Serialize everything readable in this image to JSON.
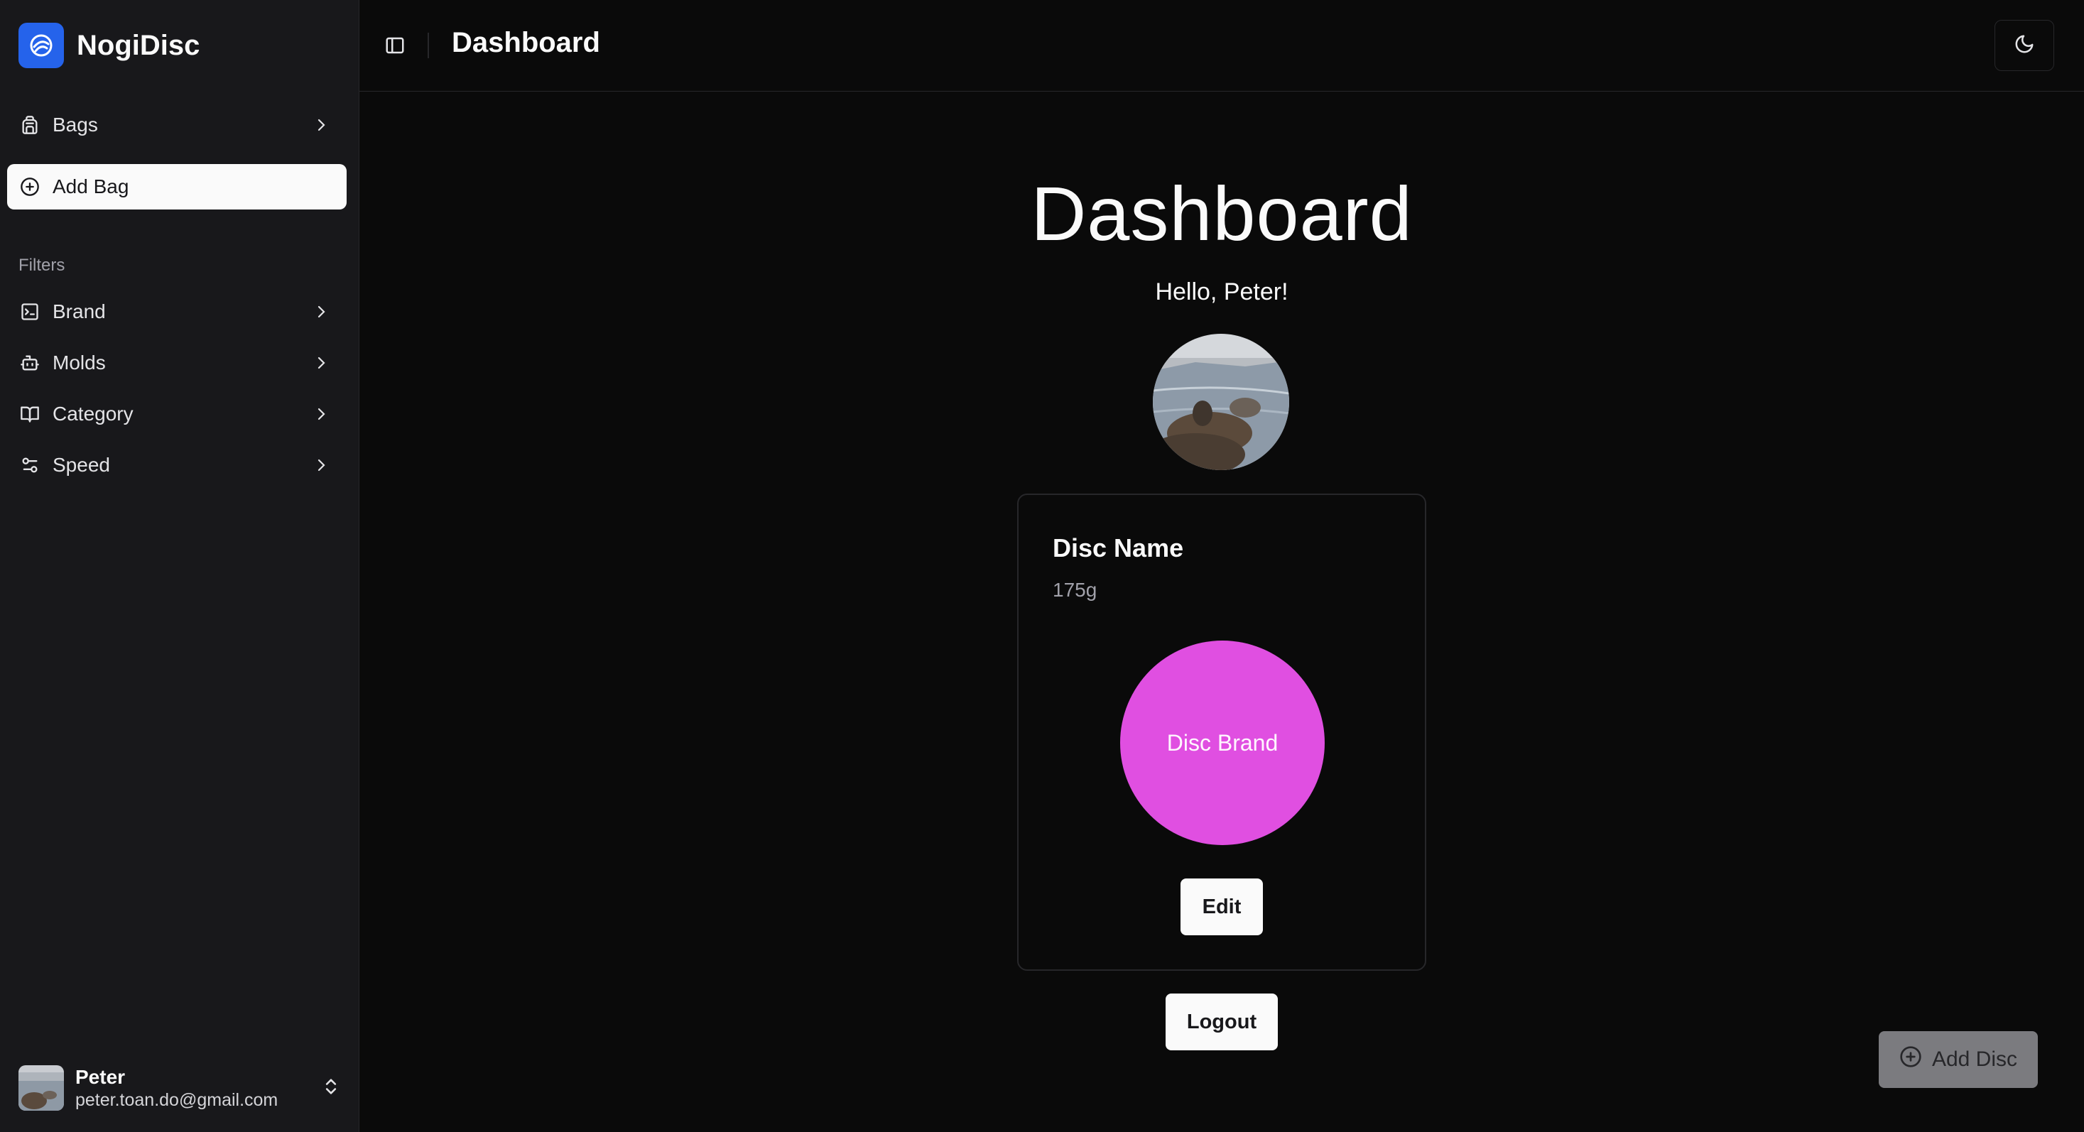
{
  "app": {
    "name": "NogiDisc"
  },
  "sidebar": {
    "items": [
      {
        "label": "Bags",
        "icon": "backpack-icon"
      },
      {
        "label": "Add Bag",
        "icon": "plus-circle-icon",
        "active": true
      }
    ],
    "filters_label": "Filters",
    "filters": [
      {
        "label": "Brand",
        "icon": "terminal-square-icon"
      },
      {
        "label": "Molds",
        "icon": "bot-icon"
      },
      {
        "label": "Category",
        "icon": "book-open-icon"
      },
      {
        "label": "Speed",
        "icon": "sliders-icon"
      }
    ]
  },
  "user": {
    "name": "Peter",
    "email": "peter.toan.do@gmail.com"
  },
  "header": {
    "title": "Dashboard"
  },
  "main": {
    "title": "Dashboard",
    "greeting": "Hello, Peter!",
    "card": {
      "title": "Disc Name",
      "weight": "175g",
      "brand_label": "Disc Brand",
      "disc_color": "#e04fe1",
      "edit_label": "Edit"
    },
    "logout_label": "Logout",
    "add_disc_label": "Add Disc"
  },
  "colors": {
    "accent": "#2563eb",
    "background": "#0a0a0a",
    "sidebar": "#18181b"
  }
}
